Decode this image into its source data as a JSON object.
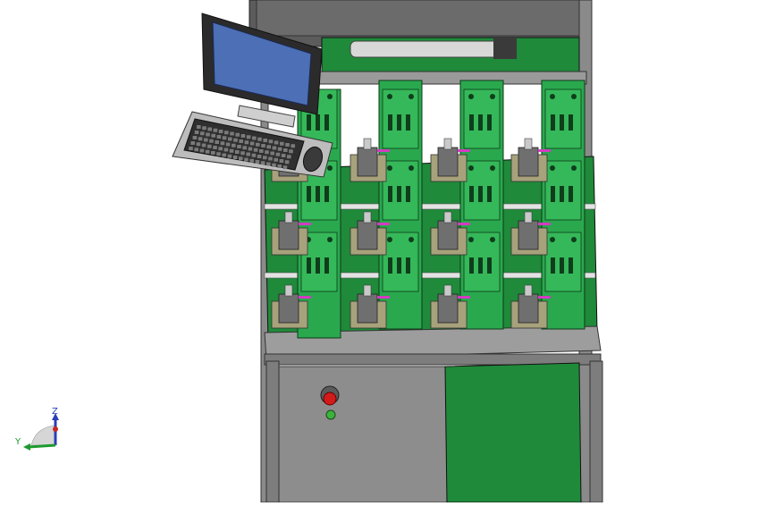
{
  "viewport": {
    "background": "#ffffff",
    "colors": {
      "frame": "#7f7f7f",
      "frame_dark": "#4a4a4a",
      "panel_green": "#1f8a3a",
      "panel_green_light": "#35b859",
      "module_green": "#2aa84e",
      "monitor_screen": "#4c6fb6",
      "monitor_bezel": "#2b2b2b",
      "stop_button": "#d11b1b",
      "indicator_light": "#3bb33b",
      "accent_magenta": "#d23cc0"
    },
    "model": {
      "name": "test-rack-assembly",
      "module_rows": 3,
      "module_columns": 4
    }
  },
  "triad": {
    "z_label": "Z",
    "y_label": "Y",
    "z_color": "#2c3db8",
    "y_color": "#1e9a2e",
    "x_color": "#c62828"
  }
}
